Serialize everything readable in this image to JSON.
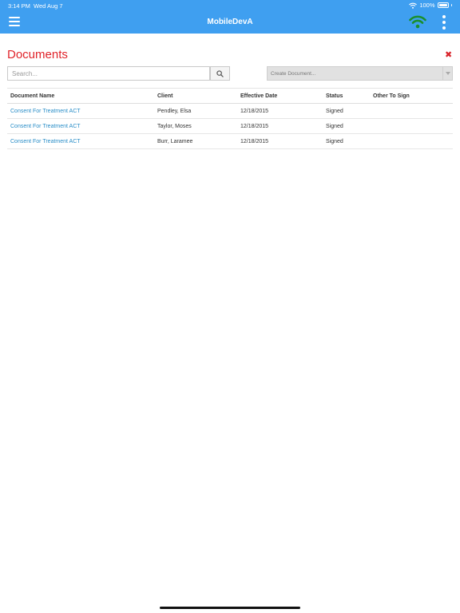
{
  "status_bar": {
    "time": "3:14 PM",
    "date": "Wed Aug 7",
    "battery_pct": "100%",
    "battery_level": 1.0
  },
  "header": {
    "title": "MobileDevA",
    "background": "#3f9ff0",
    "menu_icon": "hamburger-menu-icon",
    "status_icon": "wifi-icon",
    "status_icon_color": "#1a8f2d",
    "overflow_icon": "vertical-dots-icon"
  },
  "page": {
    "title": "Documents",
    "title_color": "#e0232a",
    "close_icon": "close-x-icon"
  },
  "search": {
    "placeholder": "Search...",
    "value": ""
  },
  "create_document": {
    "placeholder": "Create Document..."
  },
  "table": {
    "columns": [
      "Document Name",
      "Client",
      "Effective Date",
      "Status",
      "Other To Sign"
    ],
    "rows": [
      {
        "document_name": "Consent For Treatment ACT",
        "client": "Pendley, Elsa",
        "effective_date": "12/18/2015",
        "status": "Signed",
        "other_to_sign": ""
      },
      {
        "document_name": "Consent For Treatment ACT",
        "client": "Taylor, Moses",
        "effective_date": "12/18/2015",
        "status": "Signed",
        "other_to_sign": ""
      },
      {
        "document_name": "Consent For Treatment ACT",
        "client": "Burr, Laramee",
        "effective_date": "12/18/2015",
        "status": "Signed",
        "other_to_sign": ""
      }
    ],
    "link_color": "#2a8ec8"
  }
}
